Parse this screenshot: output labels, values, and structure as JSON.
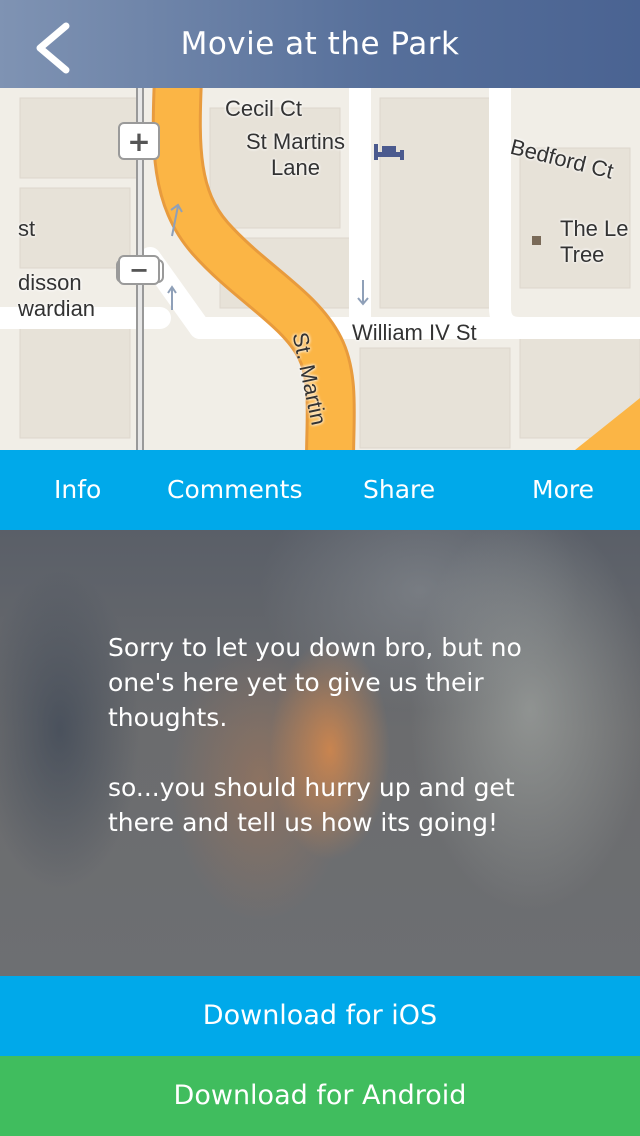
{
  "header": {
    "title": "Movie at the Park",
    "back_icon": "chevron-left-icon"
  },
  "map": {
    "labels": {
      "cecil_ct": "Cecil Ct",
      "st_martins_lane": "St Martins\nLane",
      "bedford_ct": "Bedford Ct",
      "the_le_tree": "The Le\nTree",
      "st_fragment": "st",
      "radisson_edwardian": "disson\nwardian",
      "william_iv_st": "William IV St",
      "st_martin": "St. Martin"
    },
    "zoom_in": "+",
    "zoom_out": "−",
    "road_color": "#fbb545",
    "land_color": "#f1eee7"
  },
  "tabs": [
    {
      "label": "Info"
    },
    {
      "label": "Comments"
    },
    {
      "label": "Share"
    },
    {
      "label": "More"
    }
  ],
  "content": {
    "message": "Sorry to let you down bro, but no one's here yet to give us their thoughts.\n\nso...you should hurry up and get there and tell us how its going!"
  },
  "buttons": {
    "ios": "Download for iOS",
    "android": "Download for Android"
  },
  "colors": {
    "accent_blue": "#00a9ea",
    "android_green": "#40bd5e"
  }
}
